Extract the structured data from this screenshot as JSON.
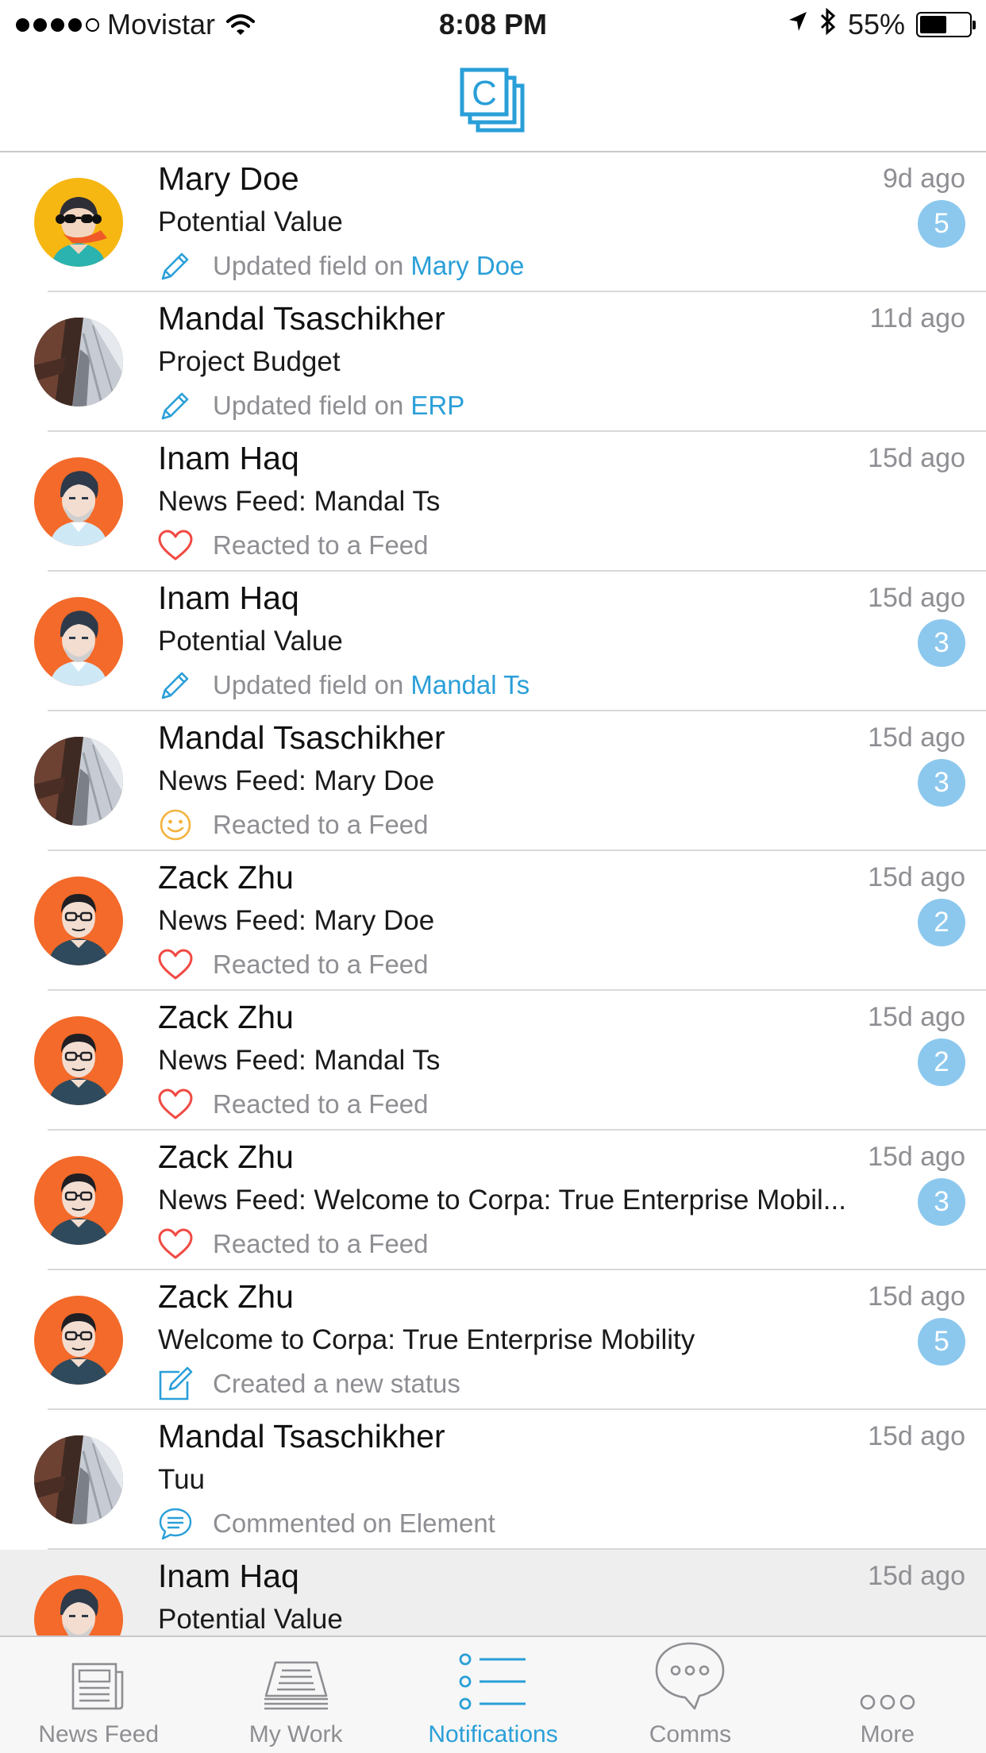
{
  "status_bar": {
    "carrier": "Movistar",
    "time": "8:08 PM",
    "battery": "55%",
    "battery_fraction": 0.55,
    "signal_bars_filled": 4,
    "signal_bars_total": 5
  },
  "nav": {
    "logo_icon": "corpa-logo-icon",
    "logo_letter": "C"
  },
  "colors": {
    "accent": "#2a9fd8",
    "badge": "#8cc8ee",
    "heart": "#f04a43",
    "smiley": "#f4b33d",
    "avatar_orange": "#f36a2a",
    "avatar_yellow": "#f6b713"
  },
  "notifications": [
    {
      "name": "Mary Doe",
      "time": "9d ago",
      "subject": "Potential Value",
      "badge": "5",
      "action_icon": "pencil-icon",
      "action_text": "Updated field on",
      "action_link": "Mary Doe",
      "avatar": "mary"
    },
    {
      "name": "Mandal Tsaschikher",
      "time": "11d ago",
      "subject": "Project Budget",
      "badge": "",
      "action_icon": "pencil-icon",
      "action_text": "Updated field on",
      "action_link": "ERP",
      "avatar": "mandal"
    },
    {
      "name": "Inam Haq",
      "time": "15d ago",
      "subject": "News Feed: Mandal Ts",
      "badge": "",
      "action_icon": "heart-icon",
      "action_text": "Reacted to a Feed",
      "action_link": "",
      "avatar": "inam"
    },
    {
      "name": "Inam Haq",
      "time": "15d ago",
      "subject": "Potential Value",
      "badge": "3",
      "action_icon": "pencil-icon",
      "action_text": "Updated field on",
      "action_link": "Mandal Ts",
      "avatar": "inam"
    },
    {
      "name": "Mandal Tsaschikher",
      "time": "15d ago",
      "subject": "News Feed: Mary Doe",
      "badge": "3",
      "action_icon": "smiley-icon",
      "action_text": "Reacted to a Feed",
      "action_link": "",
      "avatar": "mandal"
    },
    {
      "name": "Zack Zhu",
      "time": "15d ago",
      "subject": "News Feed: Mary Doe",
      "badge": "2",
      "action_icon": "heart-icon",
      "action_text": "Reacted to a Feed",
      "action_link": "",
      "avatar": "zack"
    },
    {
      "name": "Zack Zhu",
      "time": "15d ago",
      "subject": "News Feed: Mandal Ts",
      "badge": "2",
      "action_icon": "heart-icon",
      "action_text": "Reacted to a Feed",
      "action_link": "",
      "avatar": "zack"
    },
    {
      "name": "Zack Zhu",
      "time": "15d ago",
      "subject": "News Feed: Welcome to Corpa: True Enterprise Mobil...",
      "badge": "3",
      "action_icon": "heart-icon",
      "action_text": "Reacted to a Feed",
      "action_link": "",
      "avatar": "zack"
    },
    {
      "name": "Zack Zhu",
      "time": "15d ago",
      "subject": "Welcome to Corpa: True Enterprise Mobility",
      "badge": "5",
      "action_icon": "compose-icon",
      "action_text": "Created a new status",
      "action_link": "",
      "avatar": "zack"
    },
    {
      "name": "Mandal Tsaschikher",
      "time": "15d ago",
      "subject": "Tuu",
      "badge": "",
      "action_icon": "comment-icon",
      "action_text": "Commented on Element",
      "action_link": "",
      "avatar": "mandal"
    },
    {
      "name": "Inam Haq",
      "time": "15d ago",
      "subject": "Potential Value",
      "badge": "",
      "action_icon": "",
      "action_text": "",
      "action_link": "",
      "avatar": "inam",
      "highlighted": true
    }
  ],
  "tabs": [
    {
      "label": "News Feed",
      "icon": "newspaper-icon",
      "active": false
    },
    {
      "label": "My Work",
      "icon": "inbox-tray-icon",
      "active": false
    },
    {
      "label": "Notifications",
      "icon": "list-icon",
      "active": true
    },
    {
      "label": "Comms",
      "icon": "chat-bubble-icon",
      "active": false
    },
    {
      "label": "More",
      "icon": "more-dots-icon",
      "active": false
    }
  ]
}
